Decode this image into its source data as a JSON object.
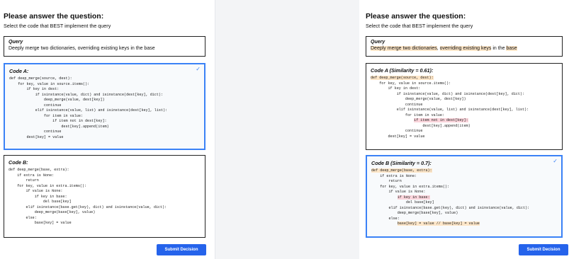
{
  "left": {
    "title": "Please answer the question:",
    "subtitle": "Select the code that BEST implement the query",
    "query_label": "Query",
    "query_text": "Deeply merge two dictionaries, overriding existing keys in the base",
    "code_a": {
      "title": "Code A:",
      "selected": true,
      "lines": [
        "def deep_merge(source, dest):",
        "    for key, value in source.items():",
        "        if key in dest:",
        "            if isinstance(value, dict) and isinstance(dest[key], dict):",
        "                deep_merge(value, dest[key])",
        "                continue",
        "            elif isinstance(value, list) and isinstance(dest[key], list):",
        "                for item in value:",
        "                    if item not in dest[key]:",
        "                        dest[key].append(item)",
        "                continue",
        "        dest[key] = value"
      ]
    },
    "code_b": {
      "title": "Code B:",
      "selected": false,
      "lines": [
        "def deep_merge(base, extra):",
        "    if extra is None:",
        "        return",
        "    for key, value in extra.items():",
        "        if value is None:",
        "            if key in base:",
        "                del base[key]",
        "        elif isinstance(base.get(key), dict) and isinstance(value, dict):",
        "            deep_merge(base[key], value)",
        "        else:",
        "            base[key] = value"
      ]
    },
    "submit_label": "Submit Decision"
  },
  "right": {
    "title": "Please answer the question:",
    "subtitle": "Select the code that BEST implement the query",
    "query_label": "Query",
    "query_text": "Deeply merge two dictionaries, overriding existing keys in the base",
    "code_a": {
      "title": "Code A (Similarity = 0.61):",
      "selected": false,
      "lines": [
        "def deep_merge(source, dest):",
        "    for key, value in source.items():",
        "        if key in dest:",
        "            if isinstance(value, dict) and isinstance(dest[key], dict):",
        "                deep_merge(value, dest[key])",
        "                continue",
        "            elif isinstance(value, list) and isinstance(dest[key], list):",
        "                for item in value:",
        "                    if item not in dest[key]:",
        "                        dest[key].append(item)",
        "                continue",
        "        dest[key] = value"
      ],
      "highlights": {
        "0": "o",
        "8": "r"
      }
    },
    "code_b": {
      "title": "Code B (Similarity = 0.7):",
      "selected": true,
      "lines": [
        "def deep_merge(base, extra):",
        "    if extra is None:",
        "        return",
        "    for key, value in extra.items():",
        "        if value is None:",
        "            if key in base:",
        "                del base[key]",
        "        elif isinstance(base.get(key), dict) and isinstance(value, dict):",
        "            deep_merge(base[key], value)",
        "        else:",
        "            base[key] = value // base[key] = value"
      ],
      "highlights": {
        "0": "o",
        "5": "r",
        "10": "o"
      }
    },
    "submit_label": "Submit Decision"
  },
  "colors": {
    "accent": "#2563eb",
    "selected_border": "#3b82f6",
    "highlight_orange": "#fde6c8",
    "highlight_red": "#fbd5dc"
  },
  "icons": {
    "selected_check": "checkmark-icon"
  }
}
